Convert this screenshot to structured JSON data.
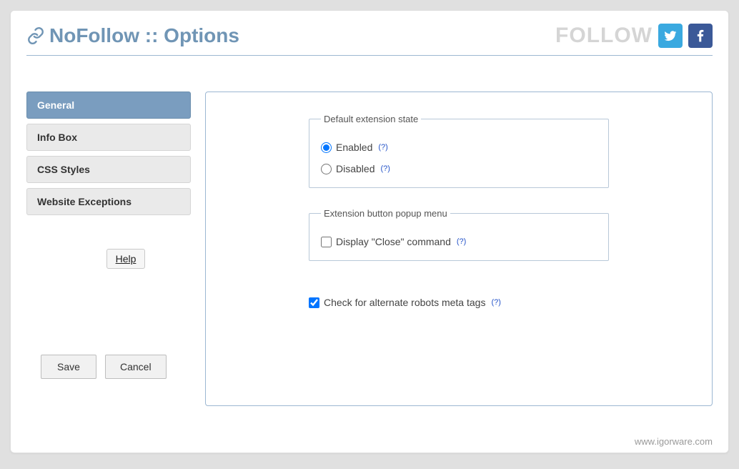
{
  "header": {
    "title": "NoFollow :: Options",
    "follow_label": "FOLLOW"
  },
  "sidebar": {
    "tabs": [
      {
        "label": "General",
        "active": true
      },
      {
        "label": "Info Box",
        "active": false
      },
      {
        "label": "CSS Styles",
        "active": false
      },
      {
        "label": "Website Exceptions",
        "active": false
      }
    ],
    "help_label": "Help",
    "save_label": "Save",
    "cancel_label": "Cancel"
  },
  "form": {
    "default_state": {
      "legend": "Default extension state",
      "enabled_label": "Enabled",
      "disabled_label": "Disabled",
      "selected": "enabled"
    },
    "popup_menu": {
      "legend": "Extension button popup menu",
      "display_close_label": "Display \"Close\" command",
      "display_close_checked": false
    },
    "alt_robots": {
      "label": "Check for alternate robots meta tags",
      "checked": true
    },
    "help_marker": "(?)"
  },
  "footer": {
    "url": "www.igorware.com"
  }
}
